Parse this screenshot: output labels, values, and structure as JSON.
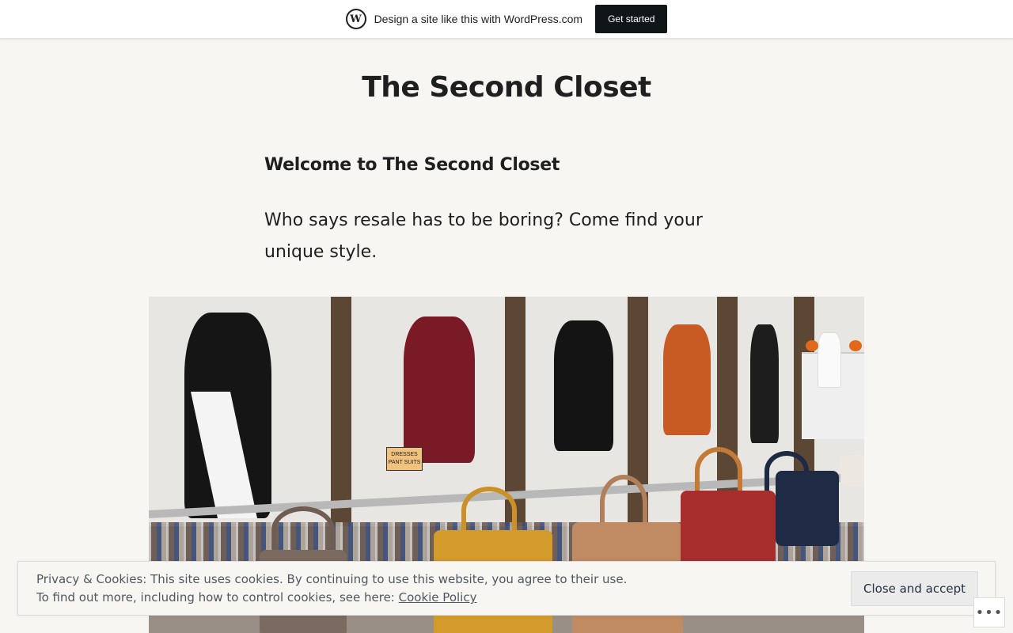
{
  "wpbar": {
    "text": "Design a site like this with WordPress.com",
    "button": "Get started",
    "logo_icon": "wordpress-logo-icon"
  },
  "site": {
    "title": "The Second Closet"
  },
  "content": {
    "heading": "Welcome to The Second Closet",
    "intro": "Who says resale has to be boring? Come find your unique style.",
    "sign_text": "DRESSES PANT SUITS"
  },
  "cookie": {
    "line1": "Privacy & Cookies: This site uses cookies. By continuing to use this website, you agree to their use.",
    "line2_prefix": "To find out more, including how to control cookies, see here: ",
    "link": "Cookie Policy",
    "accept_button": "Close and accept"
  },
  "more_button": {
    "label": "•••",
    "icon": "ellipsis-icon"
  }
}
